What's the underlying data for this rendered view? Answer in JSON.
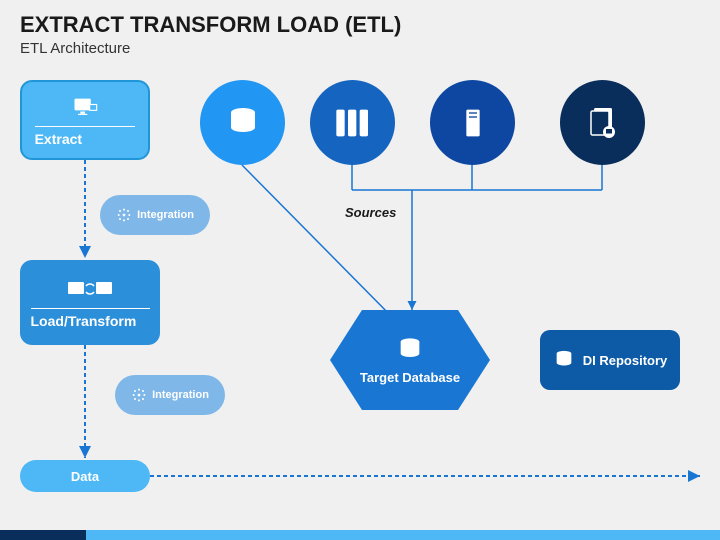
{
  "title": "EXTRACT TRANSFORM LOAD (ETL)",
  "subtitle": "ETL Architecture",
  "extract": {
    "label": "Extract"
  },
  "loadtrans": {
    "label": "Load/Transform"
  },
  "data": {
    "label": "Data"
  },
  "integration": {
    "label": "Integration"
  },
  "sources": {
    "label": "Sources"
  },
  "target": {
    "label": "Target Database"
  },
  "repo": {
    "label": "DI Repository"
  }
}
